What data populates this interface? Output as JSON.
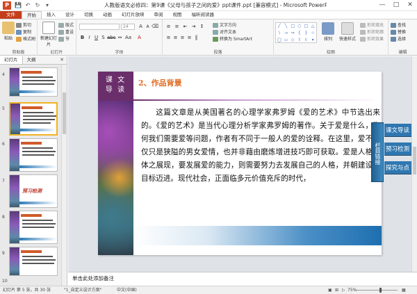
{
  "window": {
    "app_icon": "P",
    "title": "人教版语文必修四：第9课《父母与孩子之间的爱》ppt课件.ppt [兼容模式] - Microsoft PowerPoint",
    "controls": [
      "minimize-icon",
      "maximize-icon",
      "close-icon"
    ]
  },
  "ribbon_tabs": [
    "文件",
    "开始",
    "插入",
    "设计",
    "切换",
    "动画",
    "幻灯片放映",
    "审阅",
    "视图",
    "福昕阅读器"
  ],
  "ribbon": {
    "clipboard": {
      "paste": "粘贴",
      "cut": "剪切",
      "copy": "复制",
      "format_painter": "格式刷",
      "label": "剪贴板"
    },
    "slides": {
      "new_slide": "新建幻灯片",
      "layout": "版式",
      "reset": "重设",
      "section": "节",
      "label": "幻灯片"
    },
    "font": {
      "font_size": "24",
      "label": "字体"
    },
    "paragraph": {
      "text_direction": "文字方向",
      "align_text": "对齐文本",
      "smartart": "转换为 SmartArt",
      "label": "段落"
    },
    "drawing": {
      "arrange": "排列",
      "quick_styles": "快速样式",
      "shape_fill": "形状填充",
      "shape_outline": "形状轮廓",
      "shape_effects": "形状效果",
      "label": "绘图"
    },
    "editing": {
      "find": "查找",
      "replace": "替换",
      "select": "选择",
      "label": "编辑"
    }
  },
  "pane": {
    "tabs": [
      "幻灯片",
      "大纲"
    ],
    "thumbnails": [
      {
        "num": "4"
      },
      {
        "num": "5"
      },
      {
        "num": "6"
      },
      {
        "num": "7",
        "word": "预习检测"
      },
      {
        "num": "8"
      },
      {
        "num": "9"
      },
      {
        "num": "10"
      }
    ]
  },
  "slide": {
    "badge": "课 文\n导 读",
    "heading": "2、作品背景",
    "body": "这篇文章是从美国著名的心理学家弗罗姆《爱的艺术》中节选出来的。《爱的艺术》是当代心理分析学家弗罗姆的著作。关于爱是什么，为何我们需要爱等问题，作者有不同于一般人的爱的诠释。在这里，爱不仅仅只是狭隘的男女爱情，也并非藉由磨炼增进技巧即可获取。爱是人格整体之展现，要发展爱的能力，则需要努力去发展自己的人格，并朝建设性目标迈进。现代社会，正面临多元价值充斥的时代，",
    "side_tab": "栏目链接",
    "links": [
      "课文导读",
      "预习检测",
      "探究与点"
    ]
  },
  "notes_placeholder": "单击此处添加备注",
  "status": {
    "slide_info": "幻灯片 第 5 张，共 30 张",
    "theme": "\"1_自定义设计方案\"",
    "language": "中文(中国)",
    "zoom": "75%"
  }
}
